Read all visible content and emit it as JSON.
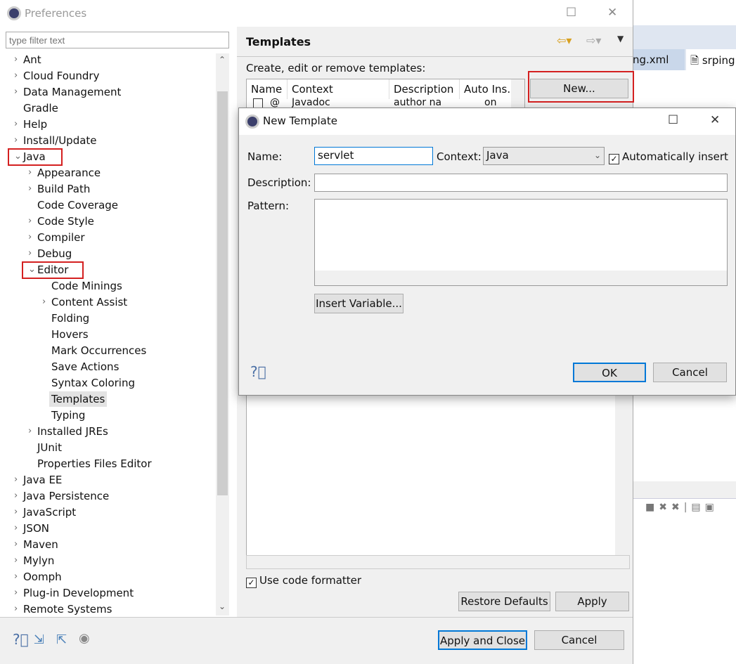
{
  "window": {
    "title": "Preferences"
  },
  "background": {
    "tab1": "ng.xml",
    "tab2": "srping."
  },
  "filter": {
    "placeholder": "type filter text"
  },
  "tree": [
    {
      "label": "Ant",
      "level": 0,
      "arrow": ">"
    },
    {
      "label": "Cloud Foundry",
      "level": 0,
      "arrow": ">"
    },
    {
      "label": "Data Management",
      "level": 0,
      "arrow": ">"
    },
    {
      "label": "Gradle",
      "level": 0,
      "arrow": ""
    },
    {
      "label": "Help",
      "level": 0,
      "arrow": ">"
    },
    {
      "label": "Install/Update",
      "level": 0,
      "arrow": ">"
    },
    {
      "label": "Java",
      "level": 0,
      "arrow": "v",
      "highlight": true
    },
    {
      "label": "Appearance",
      "level": 1,
      "arrow": ">"
    },
    {
      "label": "Build Path",
      "level": 1,
      "arrow": ">"
    },
    {
      "label": "Code Coverage",
      "level": 1,
      "arrow": ""
    },
    {
      "label": "Code Style",
      "level": 1,
      "arrow": ">"
    },
    {
      "label": "Compiler",
      "level": 1,
      "arrow": ">"
    },
    {
      "label": "Debug",
      "level": 1,
      "arrow": ">"
    },
    {
      "label": "Editor",
      "level": 1,
      "arrow": "v",
      "highlight": true
    },
    {
      "label": "Code Minings",
      "level": 2,
      "arrow": ""
    },
    {
      "label": "Content Assist",
      "level": 2,
      "arrow": ">"
    },
    {
      "label": "Folding",
      "level": 2,
      "arrow": ""
    },
    {
      "label": "Hovers",
      "level": 2,
      "arrow": ""
    },
    {
      "label": "Mark Occurrences",
      "level": 2,
      "arrow": ""
    },
    {
      "label": "Save Actions",
      "level": 2,
      "arrow": ""
    },
    {
      "label": "Syntax Coloring",
      "level": 2,
      "arrow": ""
    },
    {
      "label": "Templates",
      "level": 2,
      "arrow": "",
      "selected": true
    },
    {
      "label": "Typing",
      "level": 2,
      "arrow": ""
    },
    {
      "label": "Installed JREs",
      "level": 1,
      "arrow": ">"
    },
    {
      "label": "JUnit",
      "level": 1,
      "arrow": ""
    },
    {
      "label": "Properties Files Editor",
      "level": 1,
      "arrow": ""
    },
    {
      "label": "Java EE",
      "level": 0,
      "arrow": ">"
    },
    {
      "label": "Java Persistence",
      "level": 0,
      "arrow": ">"
    },
    {
      "label": "JavaScript",
      "level": 0,
      "arrow": ">"
    },
    {
      "label": "JSON",
      "level": 0,
      "arrow": ">"
    },
    {
      "label": "Maven",
      "level": 0,
      "arrow": ">"
    },
    {
      "label": "Mylyn",
      "level": 0,
      "arrow": ">"
    },
    {
      "label": "Oomph",
      "level": 0,
      "arrow": ">"
    },
    {
      "label": "Plug-in Development",
      "level": 0,
      "arrow": ">"
    },
    {
      "label": "Remote Systems",
      "level": 0,
      "arrow": ">"
    }
  ],
  "page": {
    "title": "Templates",
    "description": "Create, edit or remove templates:",
    "columns": [
      "Name",
      "Context",
      "Description",
      "Auto Ins."
    ],
    "row": {
      "name": "@",
      "context": "Javadoc",
      "description": "author na",
      "auto": "on"
    },
    "new_button": "New...",
    "use_formatter": "Use code formatter",
    "restore_defaults": "Restore Defaults",
    "apply": "Apply"
  },
  "footer": {
    "apply_close": "Apply and Close",
    "cancel": "Cancel"
  },
  "dialog": {
    "title": "New Template",
    "name_label": "Name:",
    "name_value": "servlet",
    "context_label": "Context:",
    "context_value": "Java",
    "auto_insert": "Automatically insert",
    "description_label": "Description:",
    "description_value": "",
    "pattern_label": "Pattern:",
    "insert_variable": "Insert Variable...",
    "ok": "OK",
    "cancel": "Cancel"
  },
  "colors": {
    "highlight": "#d42020",
    "focus": "#0078d7"
  }
}
